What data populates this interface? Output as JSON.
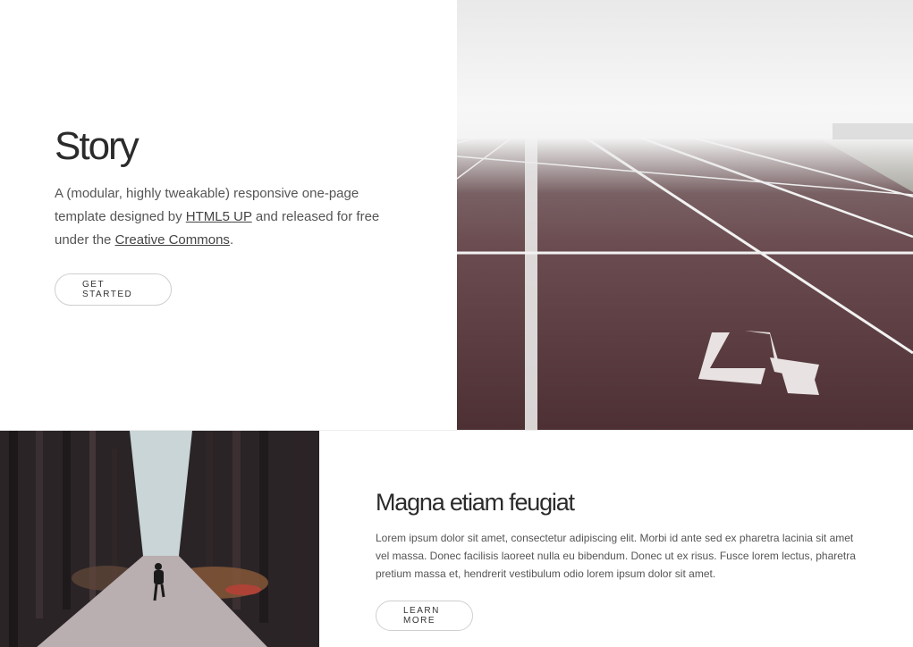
{
  "banner": {
    "title": "Story",
    "text_before": "A (modular, highly tweakable) responsive one-page template designed by ",
    "link1": "HTML5 UP",
    "text_middle": " and released for free under the ",
    "link2": "Creative Commons",
    "text_after": ".",
    "button_label": "GET STARTED",
    "image_icon": "running-track-photo"
  },
  "spotlight": {
    "title": "Magna etiam feugiat",
    "text": "Lorem ipsum dolor sit amet, consectetur adipiscing elit. Morbi id ante sed ex pharetra lacinia sit amet vel massa. Donec facilisis laoreet nulla eu bibendum. Donec ut ex risus. Fusce lorem lectus, pharetra pretium massa et, hendrerit vestibulum odio lorem ipsum dolor sit amet.",
    "button_label": "LEARN MORE",
    "image_icon": "forest-path-photo"
  },
  "colors": {
    "track": "#5a3a3d",
    "line": "#f2f2f2",
    "fog": "#efefef",
    "forest_dark": "#2a2426",
    "forest_light": "#c9d5d6",
    "path": "#b9aeb0"
  }
}
